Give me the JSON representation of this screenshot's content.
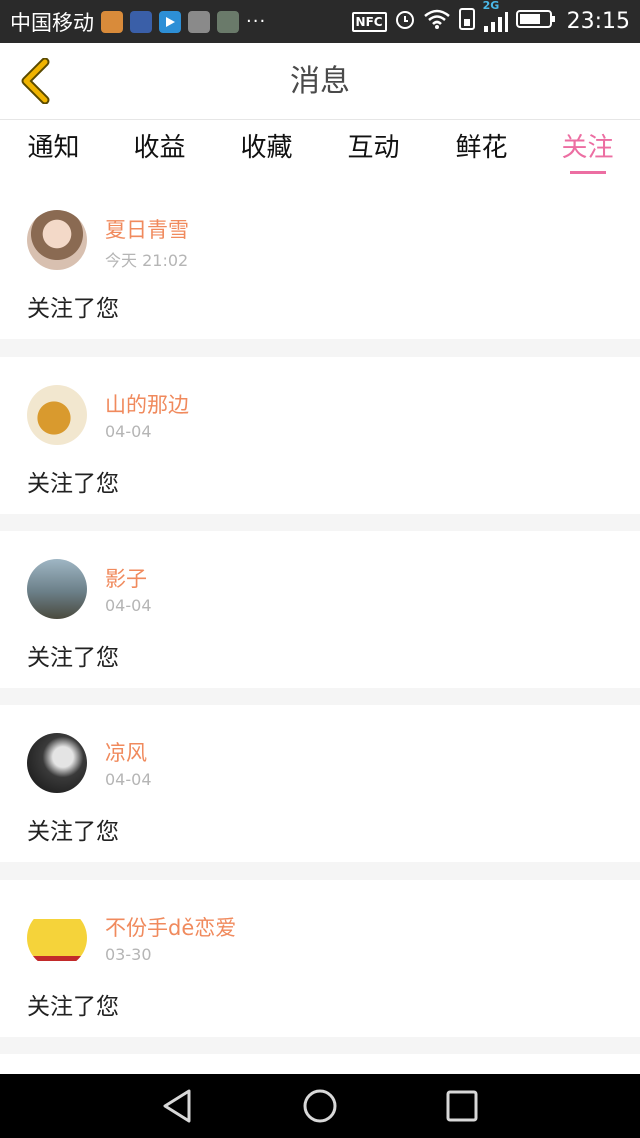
{
  "status_bar": {
    "carrier": "中国移动",
    "more": "···",
    "nfc": "NFC",
    "network": "2G",
    "time": "23:15"
  },
  "header": {
    "title": "消息",
    "back_icon": "chevron-left-icon",
    "accent": "#f0b400"
  },
  "tabs": [
    {
      "label": "通知",
      "active": false
    },
    {
      "label": "收益",
      "active": false
    },
    {
      "label": "收藏",
      "active": false
    },
    {
      "label": "互动",
      "active": false
    },
    {
      "label": "鲜花",
      "active": false
    },
    {
      "label": "关注",
      "active": true
    }
  ],
  "colors": {
    "accent_pink": "#ec6ea2",
    "username_orange": "#f08a5d",
    "time_gray": "#b5b5b5"
  },
  "notifications": [
    {
      "username": "夏日青雪",
      "time": "今天 21:02",
      "message": "关注了您"
    },
    {
      "username": "山的那边",
      "time": "04-04",
      "message": "关注了您"
    },
    {
      "username": "影子",
      "time": "04-04",
      "message": "关注了您"
    },
    {
      "username": "凉风",
      "time": "04-04",
      "message": "关注了您"
    },
    {
      "username": "不份手dě恋爱",
      "time": "03-30",
      "message": "关注了您"
    }
  ]
}
